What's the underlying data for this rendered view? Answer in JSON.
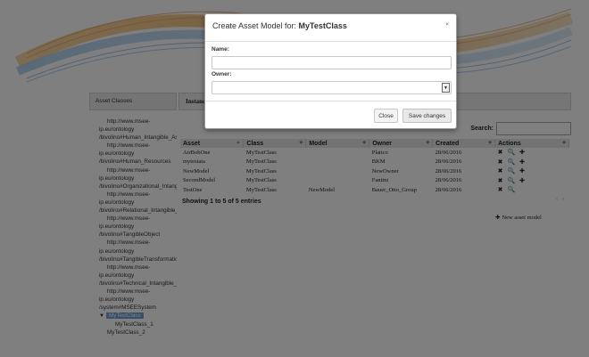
{
  "sidebar": {
    "header": "Asset Classes",
    "tree": [
      {
        "text": "http://www.msee-",
        "level": "l1"
      },
      {
        "text": "ip.eu/ontology",
        "level": "l2"
      },
      {
        "text": "/bivolino#Human_Intangible_Ass",
        "level": "l3"
      },
      {
        "text": "http://www.msee-",
        "level": "l1"
      },
      {
        "text": "ip.eu/ontology",
        "level": "l2"
      },
      {
        "text": "/bivolino#Human_Resources",
        "level": "l3"
      },
      {
        "text": "http://www.msee-",
        "level": "l1"
      },
      {
        "text": "ip.eu/ontology",
        "level": "l2"
      },
      {
        "text": "/bivolino#Organizational_Intangib",
        "level": "l3"
      },
      {
        "text": "http://www.msee-",
        "level": "l1"
      },
      {
        "text": "ip.eu/ontology",
        "level": "l2"
      },
      {
        "text": "/bivolino#Relational_Intangible_A",
        "level": "l3"
      },
      {
        "text": "http://www.msee-",
        "level": "l1"
      },
      {
        "text": "ip.eu/ontology",
        "level": "l2"
      },
      {
        "text": "/bivolino#TangibleObject",
        "level": "l3"
      },
      {
        "text": "http://www.msee-",
        "level": "l1"
      },
      {
        "text": "ip.eu/ontology",
        "level": "l2"
      },
      {
        "text": "/bivolino#TangibleTransformatio",
        "level": "l3"
      },
      {
        "text": "http://www.msee-",
        "level": "l1"
      },
      {
        "text": "ip.eu/ontology",
        "level": "l2"
      },
      {
        "text": "/bivolino#Technical_Intangible_/",
        "level": "l3"
      },
      {
        "text": "http://www.msee-",
        "level": "l1"
      },
      {
        "text": "ip.eu/ontology",
        "level": "l2"
      },
      {
        "text": "/system#MSEESystem",
        "level": "l3"
      }
    ],
    "selected": {
      "arrow": "▼",
      "label": "MyTestClass"
    },
    "child1": "MyTestClass_1",
    "child2": "MyTestClass_2"
  },
  "instances": {
    "header": "Instances",
    "search_label": "Search:",
    "columns": [
      "Asset",
      "Class",
      "Model",
      "Owner",
      "Created",
      "Actions"
    ],
    "rows": [
      {
        "asset": "AirBobOne",
        "class": "MyTestClass",
        "model": "",
        "owner": "Platico",
        "created": "28/06/2016",
        "actions": [
          "✖",
          "🔍",
          "✚"
        ]
      },
      {
        "asset": "mytestata",
        "class": "MyTestClass",
        "model": "",
        "owner": "BKM",
        "created": "28/06/2016",
        "actions": [
          "✖",
          "🔍",
          "✚"
        ]
      },
      {
        "asset": "NewModel",
        "class": "MyTestClass",
        "model": "",
        "owner": "NewOwner",
        "created": "28/06/2016",
        "actions": [
          "✖",
          "🔍",
          "✚"
        ]
      },
      {
        "asset": "SecondModel",
        "class": "MyTestClass",
        "model": "",
        "owner": "Fantini",
        "created": "28/06/2016",
        "actions": [
          "✖",
          "🔍",
          "✚"
        ]
      },
      {
        "asset": "TestOne",
        "class": "MyTestClass",
        "model": "NewModel",
        "owner": "Bauer_Otto_Group",
        "created": "28/06/2016",
        "actions": [
          "✖",
          "🔍"
        ]
      }
    ],
    "showing": "Showing 1 to 5 of 5 entries",
    "new_asset_model": "New asset model"
  },
  "modal": {
    "title_prefix": "Create Asset Model for: ",
    "title_class": "MyTestClass",
    "close_glyph": "×",
    "name_label": "Name:",
    "name_value": "",
    "owner_label": "Owner:",
    "owner_value": "",
    "close_button": "Close",
    "save_button": "Save changes"
  },
  "colors": {
    "overlay": "#000000",
    "selected_node": "#6d9fd6",
    "banner_wave_1": "#f2b86e",
    "banner_wave_2": "#7fb6e6"
  }
}
